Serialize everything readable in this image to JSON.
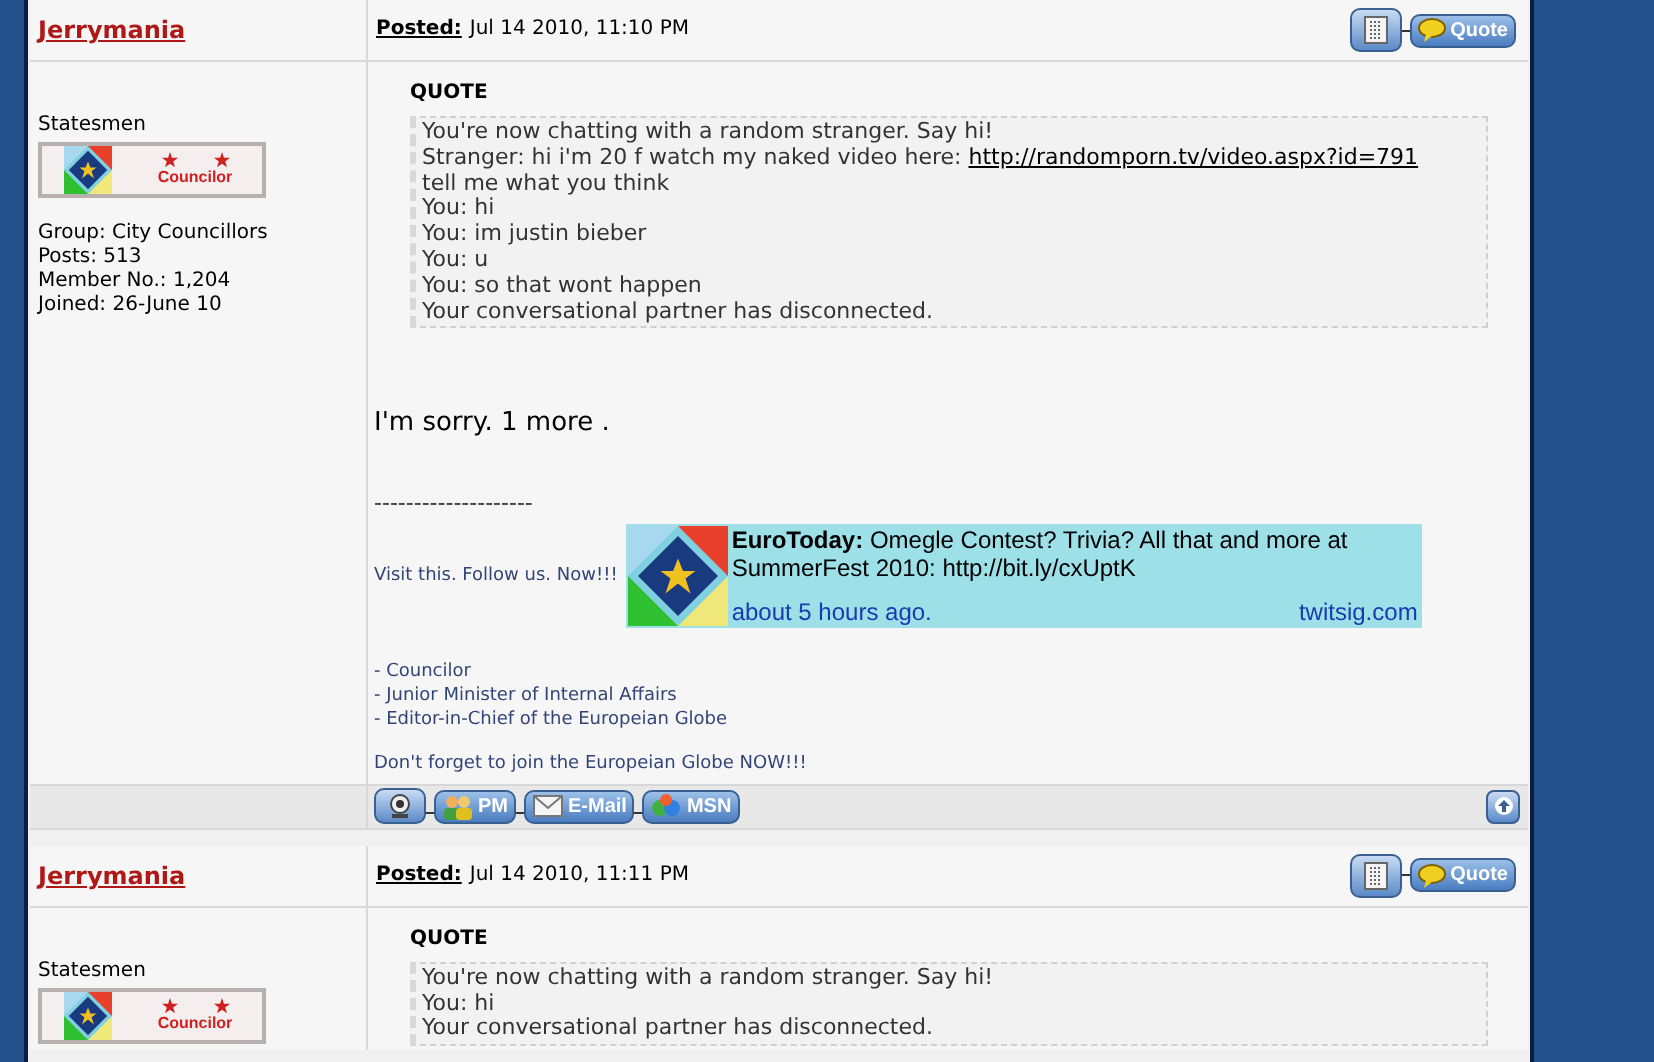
{
  "posts": [
    {
      "author": "Jerrymania",
      "posted_label": "Posted:",
      "date": "Jul 14 2010, 11:10 PM",
      "quote_button": "Quote",
      "rank": "Statesmen",
      "badge": "Councilor",
      "stats": [
        "Group: City Councillors",
        "Posts: 513",
        "Member No.: 1,204",
        "Joined: 26-June 10"
      ],
      "quote_title": "QUOTE",
      "quote_lines": [
        [
          {
            "text": "You're now chatting with a random stranger. Say hi!"
          }
        ],
        [
          {
            "text": "Stranger: hi i'm 20 f watch my naked video here: "
          },
          {
            "text": "http://randomporn.tv/video.aspx?id=791",
            "link": true
          }
        ],
        [
          {
            "text": "tell me what you think"
          }
        ],
        [
          {
            "text": "You: hi"
          }
        ],
        [
          {
            "text": "You: im justin bieber"
          }
        ],
        [
          {
            "text": "You: u"
          }
        ],
        [
          {
            "text": "You: so that wont happen"
          }
        ],
        [
          {
            "text": "Your conversational partner has disconnected."
          }
        ]
      ],
      "message": "I'm sorry. 1 more .",
      "signature": {
        "rule": "--------------------",
        "promo": "Visit this. Follow us. Now!!!",
        "tweet": {
          "user": "EuroToday:",
          "text": "Omegle Contest? Trivia? All that and more at SummerFest 2010: http://bit.ly/cxUptK",
          "time": "about 5 hours ago.",
          "source": "twitsig.com"
        },
        "roles": [
          "- Councilor",
          "- Junior Minister of Internal Affairs",
          "- Editor-in-Chief of the Europeian Globe"
        ],
        "closing": "Don't forget to join the Europeian Globe NOW!!!"
      },
      "contact_buttons": [
        "PM",
        "E-Mail",
        "MSN"
      ]
    },
    {
      "author": "Jerrymania",
      "posted_label": "Posted:",
      "date": "Jul 14 2010, 11:11 PM",
      "quote_button": "Quote",
      "rank": "Statesmen",
      "badge": "Councilor",
      "quote_title": "QUOTE",
      "quote_lines": [
        [
          {
            "text": "You're now chatting with a random stranger. Say hi!"
          }
        ],
        [
          {
            "text": "You: hi"
          }
        ],
        [
          {
            "text": "Your conversational partner has disconnected."
          }
        ]
      ]
    }
  ]
}
